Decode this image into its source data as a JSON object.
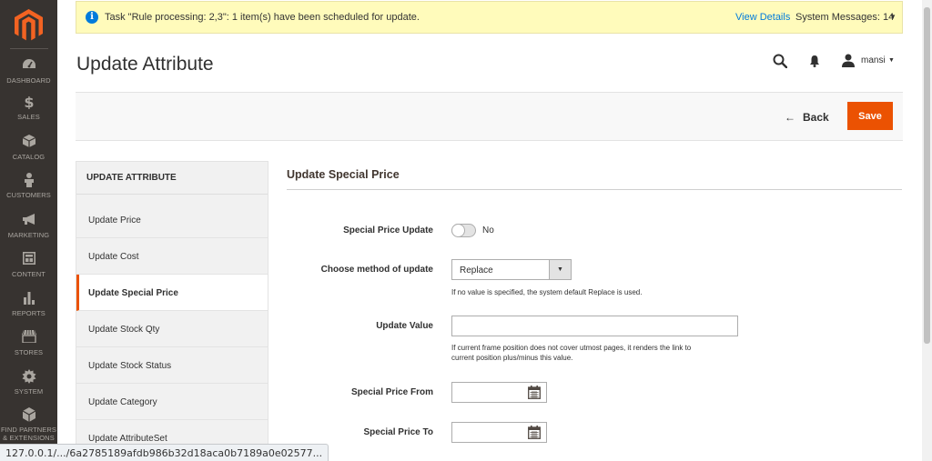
{
  "sidebar": {
    "items": [
      {
        "label": "DASHBOARD",
        "icon": "dashboard-icon"
      },
      {
        "label": "SALES",
        "icon": "dollar-icon"
      },
      {
        "label": "CATALOG",
        "icon": "box-icon"
      },
      {
        "label": "CUSTOMERS",
        "icon": "person-icon"
      },
      {
        "label": "MARKETING",
        "icon": "megaphone-icon"
      },
      {
        "label": "CONTENT",
        "icon": "layout-icon"
      },
      {
        "label": "REPORTS",
        "icon": "bar-chart-icon"
      },
      {
        "label": "STORES",
        "icon": "storefront-icon"
      },
      {
        "label": "SYSTEM",
        "icon": "gear-icon"
      },
      {
        "label1": "FIND PARTNERS",
        "label2": "& EXTENSIONS",
        "icon": "cube-icon"
      }
    ]
  },
  "message": {
    "text": "Task \"Rule processing: 2,3\": 1 item(s) have been scheduled for update.",
    "link": "View Details",
    "system": "System Messages: 14"
  },
  "header": {
    "title": "Update Attribute",
    "user": "mansi"
  },
  "actions": {
    "back": "Back",
    "save": "Save"
  },
  "tabs": {
    "heading": "UPDATE ATTRIBUTE",
    "items": [
      "Update Price",
      "Update Cost",
      "Update Special Price",
      "Update Stock Qty",
      "Update Stock Status",
      "Update Category",
      "Update AttributeSet"
    ],
    "active_index": 2
  },
  "form": {
    "section_title": "Update Special Price",
    "special_price_update_label": "Special Price Update",
    "special_price_update_value": "No",
    "method_label": "Choose method of update",
    "method_value": "Replace",
    "method_note": "If no value is specified, the system default Replace is used.",
    "update_value_label": "Update Value",
    "update_value": "",
    "update_value_note1": "If current frame position does not cover utmost pages, it renders the link to",
    "update_value_note2": "current position plus/minus this value.",
    "from_label": "Special Price From",
    "to_label": "Special Price To"
  },
  "status_url": "127.0.0.1/.../6a2785189afdb986b32d18aca0b7189a0e02577...",
  "colors": {
    "sidebar": "#373330",
    "accent": "#eb5202",
    "link": "#007bdb",
    "message_bg": "#fffbbb"
  }
}
